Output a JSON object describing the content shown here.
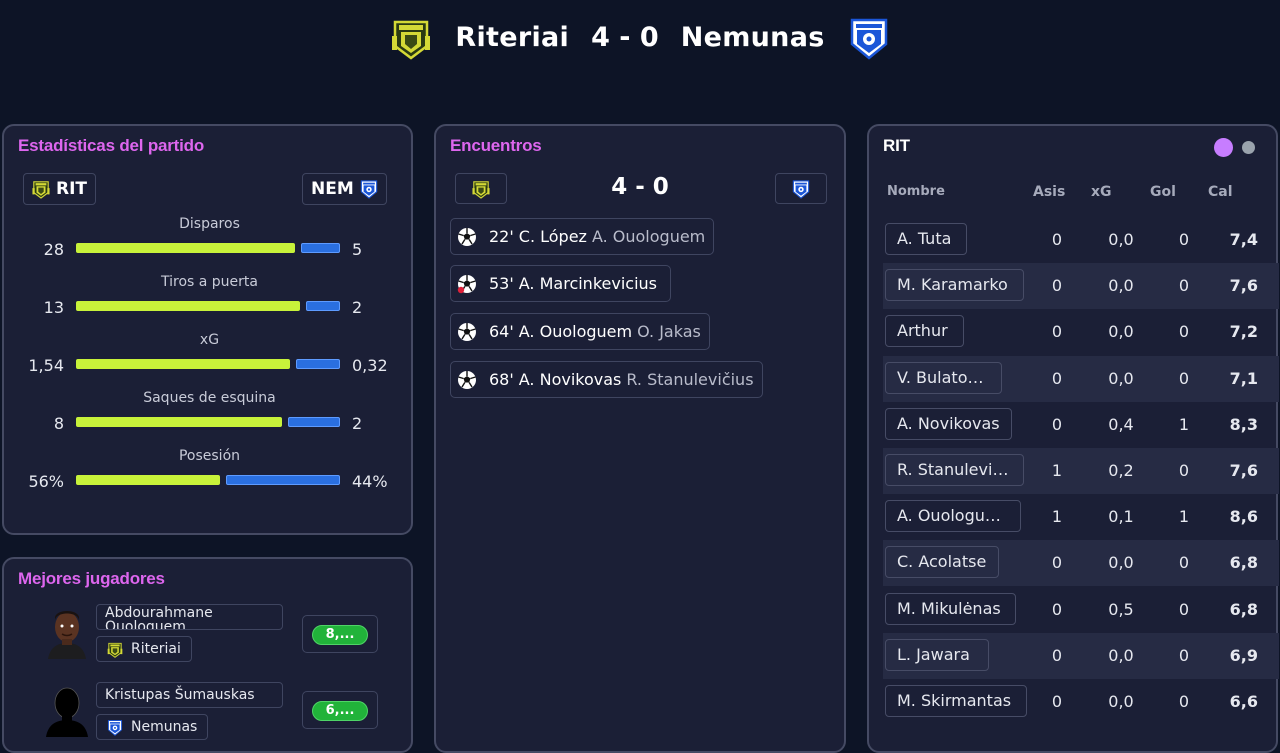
{
  "match": {
    "home_team": "Riteriai",
    "away_team": "Nemunas",
    "score": "4 - 0"
  },
  "stats_panel": {
    "title": "Estadísticas del partido",
    "home_abbr": "RIT",
    "away_abbr": "NEM",
    "stats": [
      {
        "label": "Disparos",
        "home": "28",
        "away": "5",
        "home_share": 0.85
      },
      {
        "label": "Tiros a puerta",
        "home": "13",
        "away": "2",
        "home_share": 0.87
      },
      {
        "label": "xG",
        "home": "1,54",
        "away": "0,32",
        "home_share": 0.83
      },
      {
        "label": "Saques de esquina",
        "home": "8",
        "away": "2",
        "home_share": 0.8
      },
      {
        "label": "Posesión",
        "home": "56%",
        "away": "44%",
        "home_share": 0.56
      }
    ]
  },
  "best_players": {
    "title": "Mejores jugadores",
    "players": [
      {
        "name": "Abdourahmane Ouologuem",
        "club": "Riteriai",
        "rating": "8,..."
      },
      {
        "name": "Kristupas Šumauskas",
        "club": "Nemunas",
        "rating": "6,..."
      }
    ]
  },
  "encounters": {
    "title": "Encuentros",
    "score": "4 - 0",
    "events": [
      {
        "minute": "22'",
        "scorer": "C. López",
        "assist": "A. Ouologuem",
        "icon": "football-icon"
      },
      {
        "minute": "53'",
        "scorer": "A. Marcinkevicius",
        "assist": "",
        "icon": "own-goal-icon"
      },
      {
        "minute": "64'",
        "scorer": "A. Ouologuem",
        "assist": "O. Jakas",
        "icon": "football-icon"
      },
      {
        "minute": "68'",
        "scorer": "A. Novikovas",
        "assist": "R. Stanulevičius",
        "icon": "football-icon"
      }
    ]
  },
  "team_table": {
    "title": "RIT",
    "active_dot_color": "#c77dff",
    "inactive_dot_color": "#9aa3ad",
    "headers": {
      "name": "Nombre",
      "assists": "Asis",
      "xg": "xG",
      "goals": "Gol",
      "rating": "Cal"
    },
    "rows": [
      {
        "name": "A. Tuta",
        "assists": "0",
        "xg": "0,0",
        "goals": "0",
        "rating": "7,4"
      },
      {
        "name": "M. Karamarko",
        "assists": "0",
        "xg": "0,0",
        "goals": "0",
        "rating": "7,6"
      },
      {
        "name": "Arthur",
        "assists": "0",
        "xg": "0,0",
        "goals": "0",
        "rating": "7,2"
      },
      {
        "name": "V. Bulatović",
        "assists": "0",
        "xg": "0,0",
        "goals": "0",
        "rating": "7,1"
      },
      {
        "name": "A. Novikovas",
        "assists": "0",
        "xg": "0,4",
        "goals": "1",
        "rating": "8,3"
      },
      {
        "name": "R. Stanulevičius",
        "assists": "1",
        "xg": "0,2",
        "goals": "0",
        "rating": "7,6"
      },
      {
        "name": "A. Ouologuem",
        "assists": "1",
        "xg": "0,1",
        "goals": "1",
        "rating": "8,6"
      },
      {
        "name": "C. Acolatse",
        "assists": "0",
        "xg": "0,0",
        "goals": "0",
        "rating": "6,8"
      },
      {
        "name": "M. Mikulėnas",
        "assists": "0",
        "xg": "0,5",
        "goals": "0",
        "rating": "6,8"
      },
      {
        "name": "L. Jawara",
        "assists": "0",
        "xg": "0,0",
        "goals": "0",
        "rating": "6,9"
      },
      {
        "name": "M. Skirmantas",
        "assists": "0",
        "xg": "0,0",
        "goals": "0",
        "rating": "6,6"
      }
    ]
  },
  "colors": {
    "accent_title": "#dd66ee",
    "home_bar": "#c8f23a",
    "away_bar": "#2a6fe0",
    "rating_pill": "#21b33a"
  }
}
